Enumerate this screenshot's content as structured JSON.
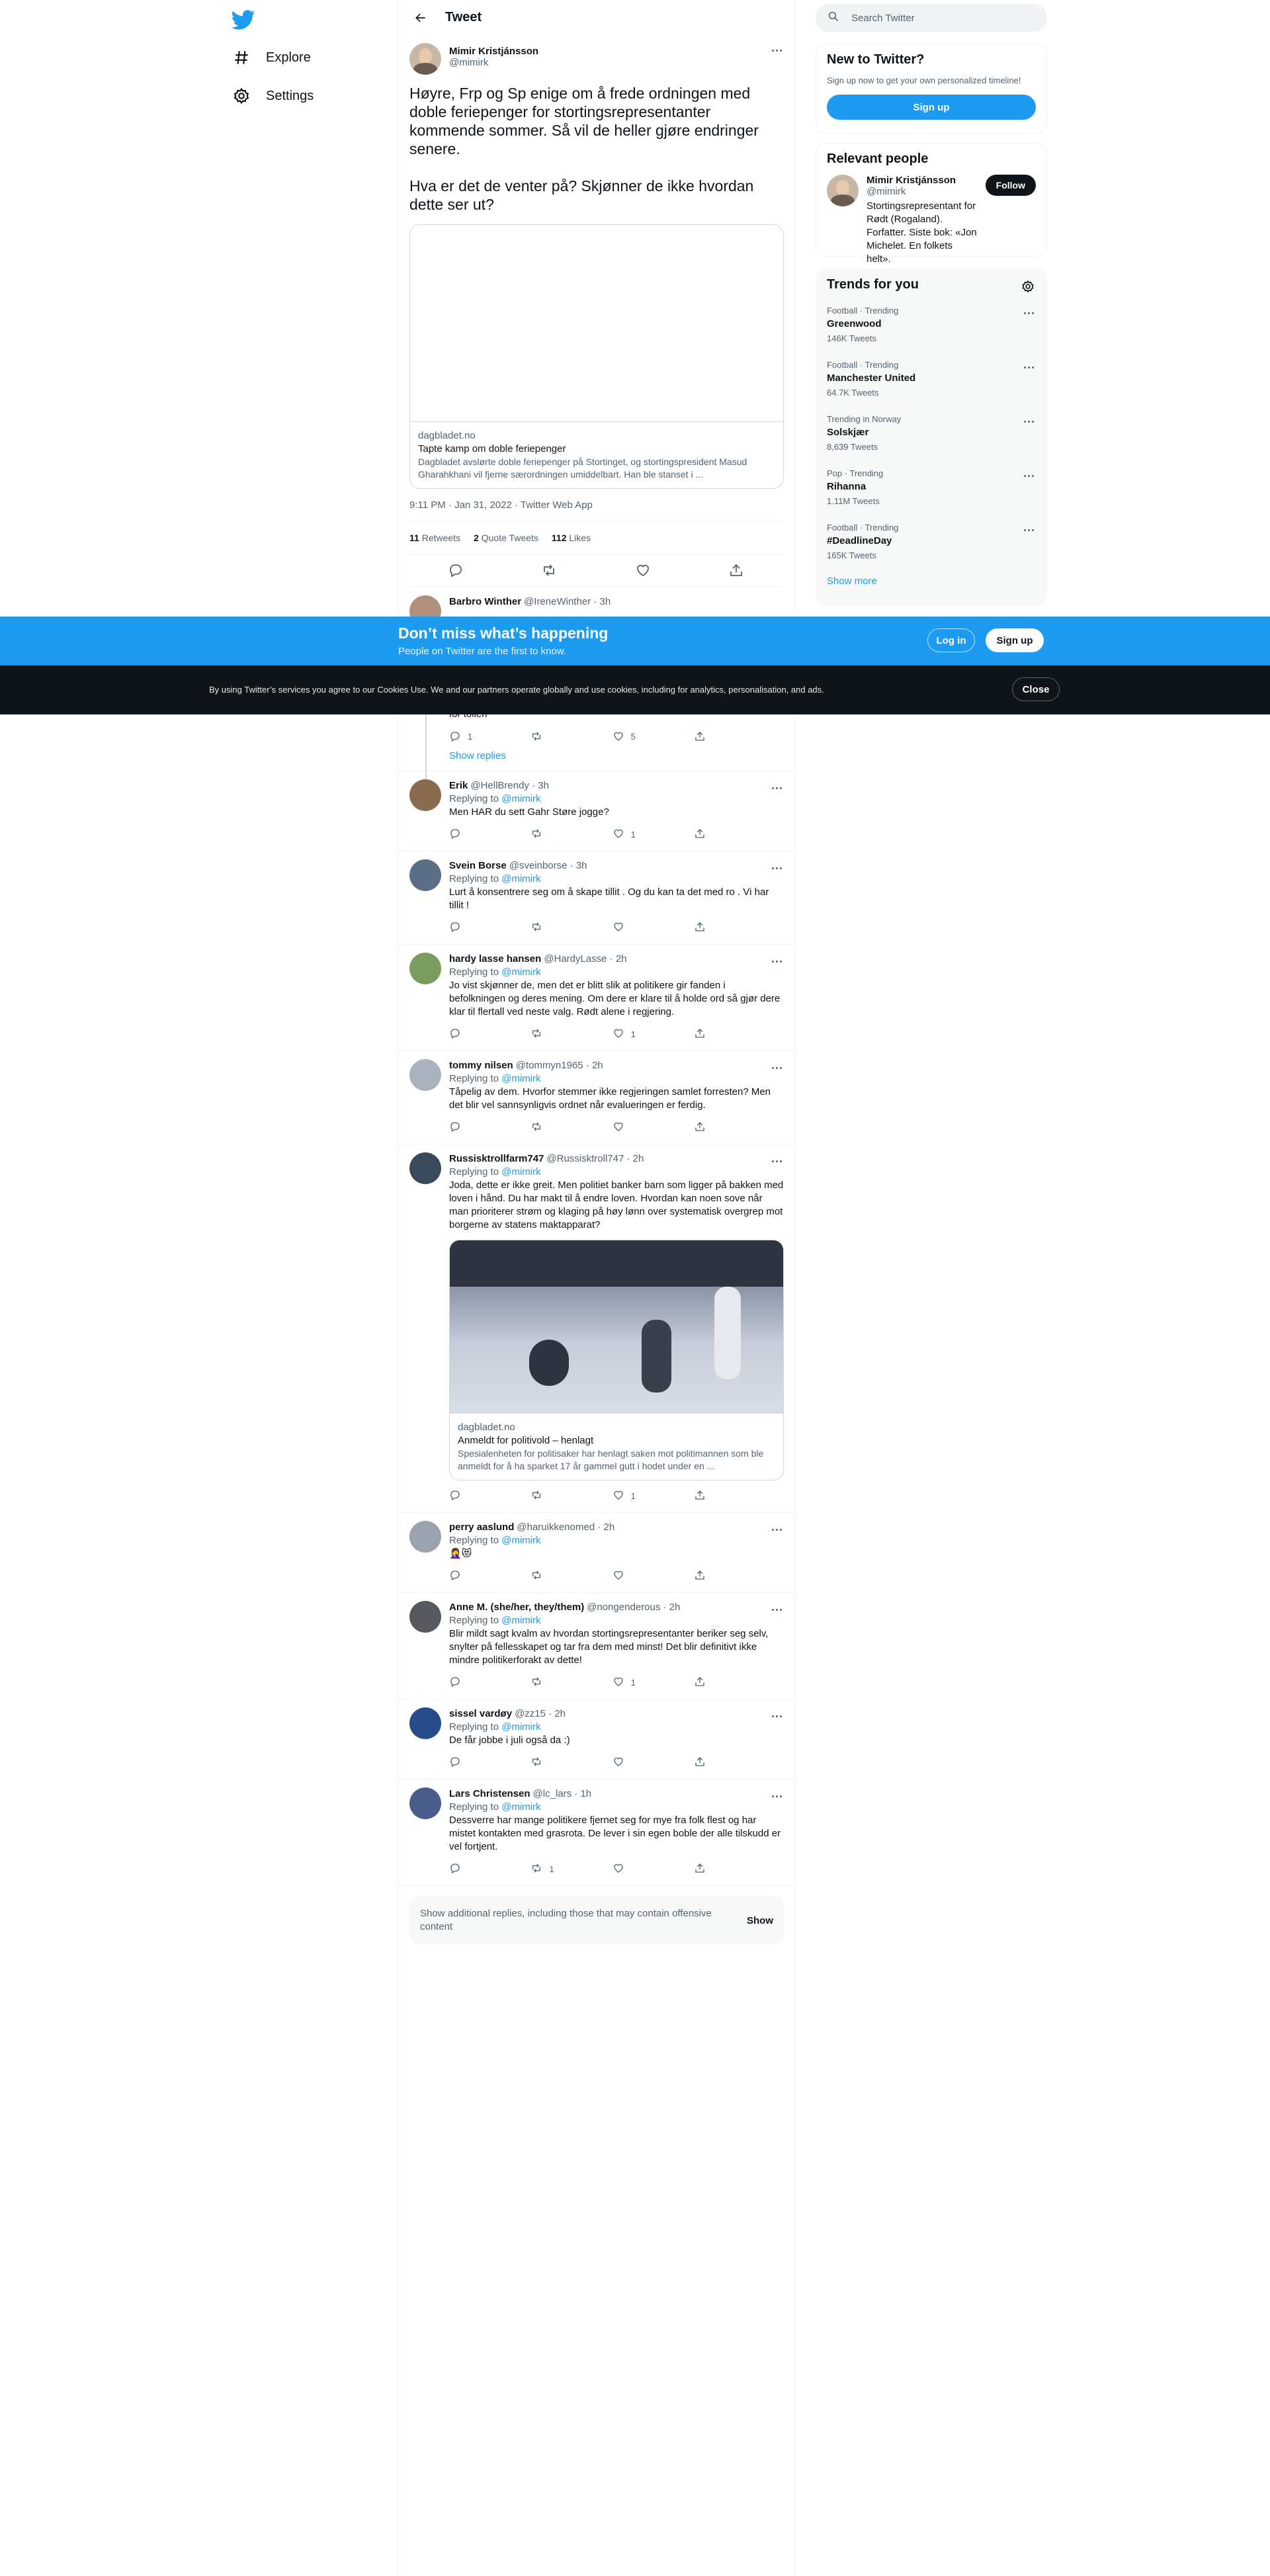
{
  "nav": {
    "items": [
      {
        "label": "Explore",
        "icon": "hashtag-icon"
      },
      {
        "label": "Settings",
        "icon": "gear-icon"
      }
    ]
  },
  "header": {
    "title": "Tweet"
  },
  "tweet": {
    "author_name": "Mimir Kristjánsson",
    "author_handle": "@mimirk",
    "text": "Høyre, Frp og Sp enige om å frede ordningen med doble feriepenger for stortingsrepresentanter kommende sommer. Så vil de heller gjøre endringer senere.\n\nHva er det de venter på? Skjønner de ikke hvordan dette ser ut?",
    "card": {
      "domain": "dagbladet.no",
      "title": "Tapte kamp om doble feriepenger",
      "description": "Dagbladet avslørte doble feriepenger på Stortinget, og stortingspresident Masud Gharahkhani vil fjerne særordningen umiddelbart. Han ble stanset i ..."
    },
    "timestamp": "9:11 PM · Jan 31, 2022 · Twitter Web App",
    "retweets": "11",
    "retweets_label": "Retweets",
    "quotes": "2",
    "quotes_label": "Quote Tweets",
    "likes": "112",
    "likes_label": "Likes"
  },
  "partial_reply": {
    "name": "Barbro Winther",
    "meta": "@IreneWinther · 3h",
    "text_tail": "for tollen",
    "replies": "1",
    "likes": "5"
  },
  "show_replies_label": "Show replies",
  "replying_prefix": "Replying to",
  "replying_handle": "@mimirk",
  "replies": [
    {
      "name": "Erik",
      "meta": "@HellBrendy · 3h",
      "text": "Men HAR du sett Gahr Støre jogge?",
      "reply_count": "",
      "rt_count": "",
      "like_count": "1"
    },
    {
      "name": "Svein Borse",
      "meta": "@sveinborse · 3h",
      "text": "Lurt å konsentrere seg om å skape tillit . Og du kan ta det med ro . Vi har tillit !",
      "reply_count": "",
      "rt_count": "",
      "like_count": ""
    },
    {
      "name": "hardy lasse hansen",
      "meta": "@HardyLasse · 2h",
      "text": "Jo vist skjønner de, men det er blitt slik at politikere gir fanden i befolkningen og deres mening. Om dere er klare til å holde ord så gjør dere klar til flertall ved neste valg. Rødt alene i regjering.",
      "reply_count": "",
      "rt_count": "",
      "like_count": "1"
    },
    {
      "name": "tommy nilsen",
      "meta": "@tommyn1965 · 2h",
      "text": "Tåpelig av dem. Hvorfor stemmer ikke regjeringen samlet forresten? Men det blir vel sannsynligvis ordnet når evalueringen er ferdig.",
      "reply_count": "",
      "rt_count": "",
      "like_count": ""
    },
    {
      "name": "Russisktrollfarm747",
      "meta": "@Russisktroll747 · 2h",
      "text": "Joda, dette er ikke greit. Men politiet banker barn som ligger på bakken med loven i hånd. Du har makt til å endre loven. Hvordan kan noen sove når man prioriterer strøm og klaging på høy lønn over systematisk overgrep mot borgerne av statens maktapparat?",
      "reply_count": "",
      "rt_count": "",
      "like_count": "1",
      "card": {
        "domain": "dagbladet.no",
        "title": "Anmeldt for politivold – henlagt",
        "description": "Spesialenheten for politisaker har henlagt saken mot politimannen som ble anmeldt for å ha sparket 17 år gammel gutt i hodet under en ..."
      }
    },
    {
      "name": "perry aaslund",
      "meta": "@haruikkenomed · 2h",
      "text": "🤦‍♀️😻",
      "reply_count": "",
      "rt_count": "",
      "like_count": ""
    },
    {
      "name": "Anne M. (she/her, they/them)",
      "meta": "@nongenderous · 2h",
      "text": "Blir mildt sagt kvalm av hvordan stortingsrepresentanter beriker seg selv, snylter på fellesskapet og tar fra dem med minst! Det blir definitivt ikke mindre politikerforakt av dette!",
      "reply_count": "",
      "rt_count": "",
      "like_count": "1"
    },
    {
      "name": "sissel vardøy",
      "meta": "@zz15 · 2h",
      "text": "De får jobbe i juli også da :)",
      "reply_count": "",
      "rt_count": "",
      "like_count": ""
    },
    {
      "name": "Lars Christensen",
      "meta": "@lc_lars · 1h",
      "text": "Dessverre har mange politikere fjernet seg for mye fra folk flest og har mistet kontakten med grasrota. De lever i sin egen boble der alle tilskudd er vel fortjent.",
      "reply_count": "",
      "rt_count": "1",
      "like_count": ""
    }
  ],
  "additional": {
    "text": "Show additional replies, including those that may contain offensive content",
    "button": "Show"
  },
  "search": {
    "placeholder": "Search Twitter"
  },
  "new_to_twitter": {
    "title": "New to Twitter?",
    "subtitle": "Sign up now to get your own personalized timeline!",
    "button": "Sign up"
  },
  "relevant": {
    "title": "Relevant people",
    "name": "Mimir Kristjánsson",
    "handle": "@mimirk",
    "button": "Follow",
    "bio": "Stortingsrepresentant for Rødt (Rogaland). Forfatter. Siste bok: «Jon Michelet. En folkets helt»."
  },
  "trends": {
    "title": "Trends for you",
    "items": [
      {
        "context": "Football · Trending",
        "name": "Greenwood",
        "count": "146K Tweets"
      },
      {
        "context": "Football · Trending",
        "name": "Manchester United",
        "count": "64.7K Tweets"
      },
      {
        "context": "Trending in Norway",
        "name": "Solskjær",
        "count": "8,639 Tweets"
      },
      {
        "context": "Pop · Trending",
        "name": "Rihanna",
        "count": "1.11M Tweets"
      },
      {
        "context": "Football · Trending",
        "name": "#DeadlineDay",
        "count": "165K Tweets"
      }
    ],
    "show_more": "Show more"
  },
  "promo": {
    "title": "Don’t miss what’s happening",
    "subtitle": "People on Twitter are the first to know.",
    "login": "Log in",
    "signup": "Sign up"
  },
  "cookie": {
    "text": "By using Twitter’s services you agree to our Cookies Use. We and our partners operate globally and use cookies, including for analytics, personalisation, and ads.",
    "close": "Close"
  },
  "colors": {
    "accent": "#1d9bf0",
    "text": "#0f1419",
    "secondary": "#536471",
    "border": "#eff3f4"
  }
}
